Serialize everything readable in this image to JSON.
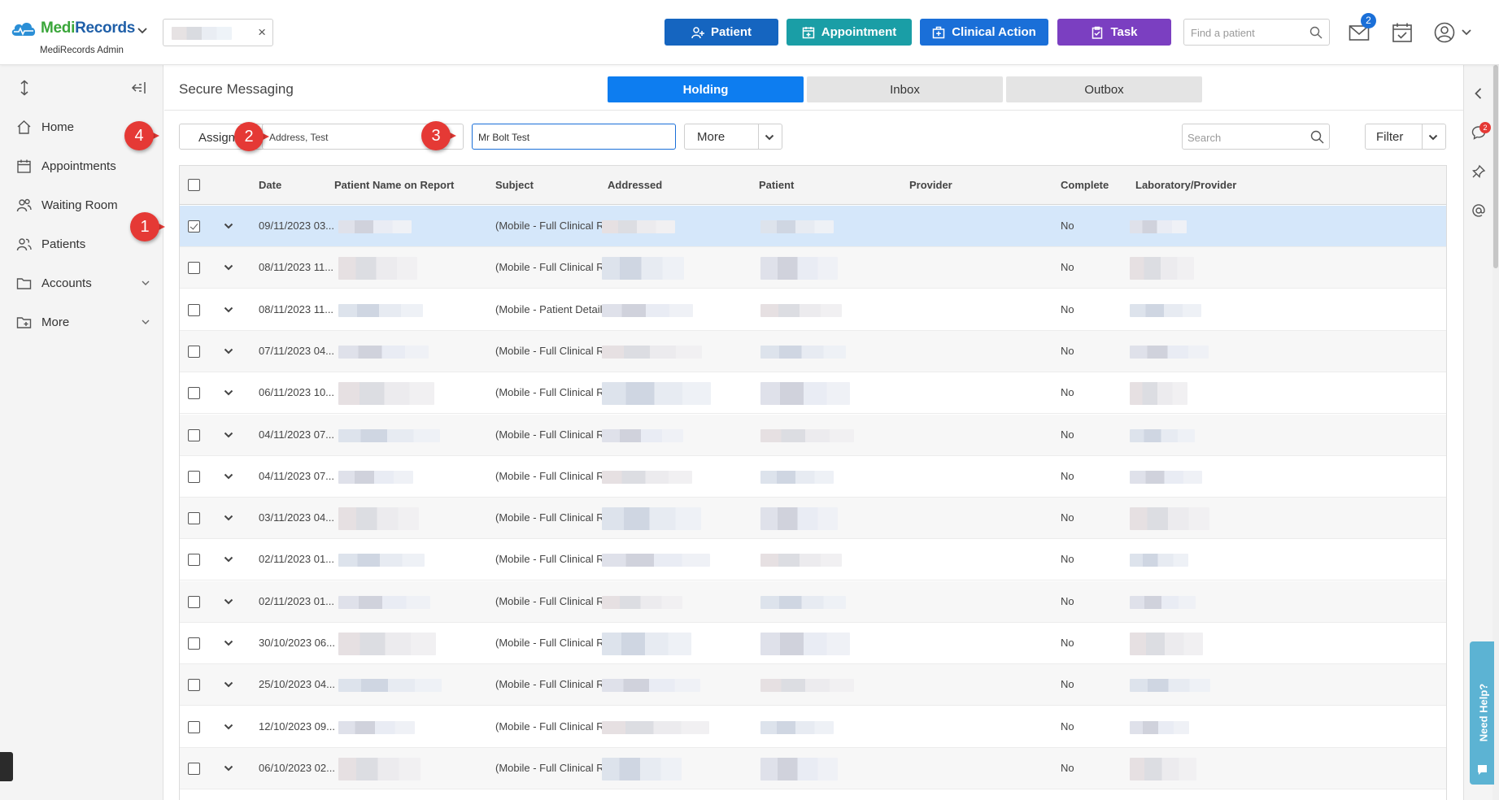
{
  "app": {
    "brand_part1": "Medi",
    "brand_part2": "Records",
    "subtitle": "MediRecords Admin",
    "colors": {
      "brand_green": "#3aa63a",
      "brand_blue": "#1f5fa8"
    }
  },
  "header": {
    "buttons": {
      "patient": "Patient",
      "appointment": "Appointment",
      "clinical_action": "Clinical Action",
      "task": "Task"
    },
    "button_colors": {
      "patient": "#1565c0",
      "appointment": "#1a9ea6",
      "clinical_action": "#1a6fd8",
      "task": "#7b3fc1"
    },
    "find_placeholder": "Find a patient",
    "mail_badge": "2",
    "icons": [
      "mail-icon",
      "calendar-check-icon",
      "user-circle-icon"
    ]
  },
  "sidebar": {
    "items": [
      {
        "label": "Home",
        "icon": "home-icon"
      },
      {
        "label": "Appointments",
        "icon": "calendar-icon"
      },
      {
        "label": "Waiting Room",
        "icon": "users-icon"
      },
      {
        "label": "Patients",
        "icon": "user-group-icon"
      },
      {
        "label": "Accounts",
        "icon": "folder-icon",
        "expandable": true
      },
      {
        "label": "More",
        "icon": "folder-plus-icon",
        "expandable": true
      }
    ]
  },
  "page": {
    "title": "Secure Messaging",
    "tabs": [
      {
        "label": "Holding",
        "active": true
      },
      {
        "label": "Inbox",
        "active": false
      },
      {
        "label": "Outbox",
        "active": false
      }
    ],
    "toolbar": {
      "assign_label": "Assign",
      "address_value": "Address, Test",
      "patient_value": "Mr Bolt Test",
      "more_label": "More",
      "search_placeholder": "Search",
      "filter_label": "Filter"
    }
  },
  "table": {
    "columns": [
      "Date",
      "Patient Name on Report",
      "Subject",
      "Addressed",
      "Patient",
      "Provider",
      "Complete",
      "Laboratory/Provider"
    ],
    "rows": [
      {
        "date": "09/11/2023 03...",
        "subject": "(Mobile - Full Clinical R...",
        "complete": "No",
        "selected": true
      },
      {
        "date": "08/11/2023 11...",
        "subject": "(Mobile - Full Clinical R...",
        "complete": "No"
      },
      {
        "date": "08/11/2023 11...",
        "subject": "(Mobile - Patient Detail...",
        "complete": "No"
      },
      {
        "date": "07/11/2023 04...",
        "subject": "(Mobile - Full Clinical R...",
        "complete": "No"
      },
      {
        "date": "06/11/2023 10...",
        "subject": "(Mobile - Full Clinical R...",
        "complete": "No"
      },
      {
        "date": "04/11/2023 07...",
        "subject": "(Mobile - Full Clinical R...",
        "complete": "No"
      },
      {
        "date": "04/11/2023 07...",
        "subject": "(Mobile - Full Clinical R...",
        "complete": "No"
      },
      {
        "date": "03/11/2023 04...",
        "subject": "(Mobile - Full Clinical R...",
        "complete": "No"
      },
      {
        "date": "02/11/2023 01...",
        "subject": "(Mobile - Full Clinical R...",
        "complete": "No"
      },
      {
        "date": "02/11/2023 01...",
        "subject": "(Mobile - Full Clinical R...",
        "complete": "No"
      },
      {
        "date": "30/10/2023 06...",
        "subject": "(Mobile - Full Clinical R...",
        "complete": "No"
      },
      {
        "date": "25/10/2023 04...",
        "subject": "(Mobile - Full Clinical R...",
        "complete": "No"
      },
      {
        "date": "12/10/2023 09...",
        "subject": "(Mobile - Full Clinical R...",
        "complete": "No"
      },
      {
        "date": "06/10/2023 02...",
        "subject": "(Mobile - Full Clinical R...",
        "complete": "No"
      }
    ]
  },
  "right_rail": {
    "chat_badge": "2",
    "help_label": "Need Help?"
  },
  "callouts": [
    "1",
    "2",
    "3",
    "4"
  ]
}
